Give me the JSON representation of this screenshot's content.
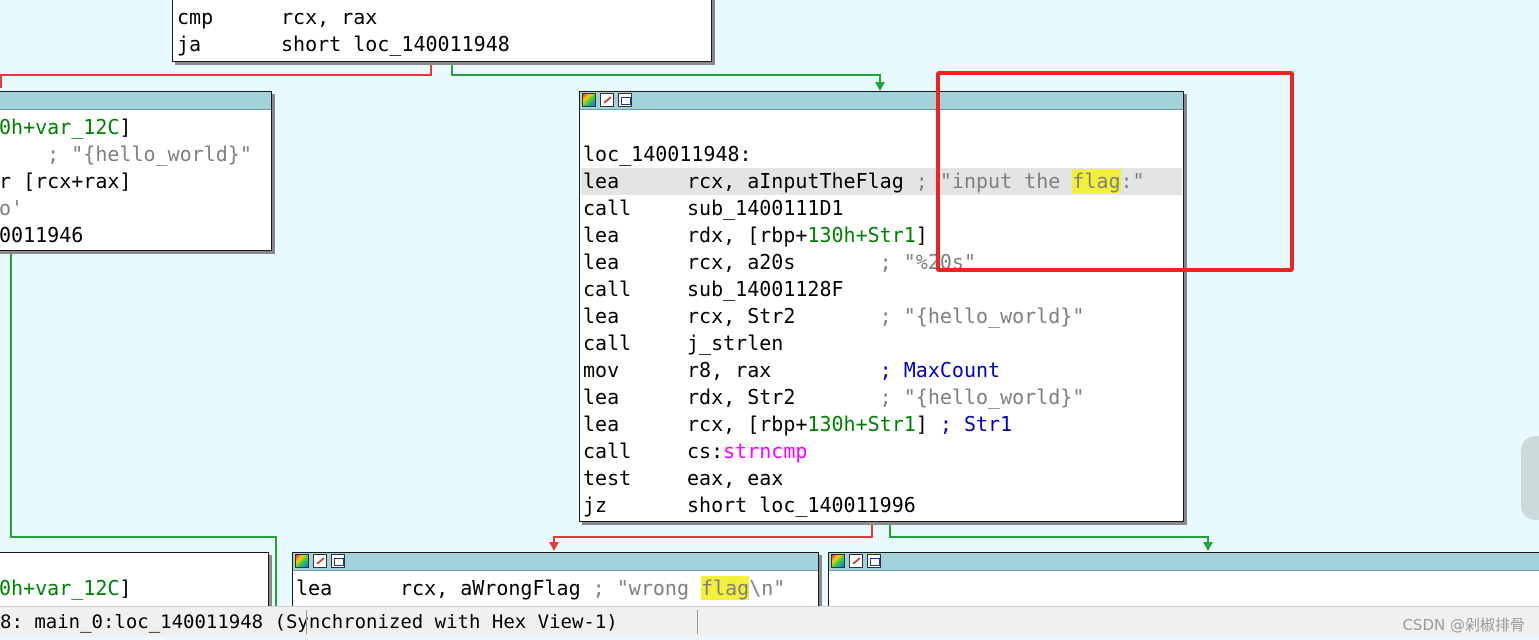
{
  "top_block": {
    "lines": [
      {
        "mnemonic": "cmp",
        "operands": "rcx, rax"
      },
      {
        "mnemonic": "ja",
        "operands": "short loc_140011948"
      }
    ]
  },
  "left_block": {
    "l1_green": "0h+var_12C",
    "l1_end": "]",
    "l2": "    ; \"{hello_world}\"",
    "l3": "r [rcx+rax]",
    "l4": "o'",
    "l5": "0011946"
  },
  "main_block": {
    "label": "loc_140011948:",
    "lines": [
      {
        "mnemonic": "lea",
        "op": "rcx, aInputTheFlag",
        "comment_pre": " ; \"input the ",
        "comment_hl": "flag",
        "comment_post": ":\""
      },
      {
        "mnemonic": "call",
        "op": "sub_1400111D1"
      },
      {
        "mnemonic": "lea",
        "op_pre": "rdx, [rbp+",
        "op_green": "130h+Str1",
        "op_post": "]"
      },
      {
        "mnemonic": "lea",
        "op": "rcx, a20s       ",
        "comment": "; \"%20s\""
      },
      {
        "mnemonic": "call",
        "op": "sub_14001128F"
      },
      {
        "mnemonic": "lea",
        "op": "rcx, Str2       ",
        "comment": "; \"{hello_world}\""
      },
      {
        "mnemonic": "call",
        "op": "j_strlen"
      },
      {
        "mnemonic": "mov",
        "op": "r8, rax         ",
        "comment_blue": "; MaxCount"
      },
      {
        "mnemonic": "lea",
        "op": "rdx, Str2       ",
        "comment": "; \"{hello_world}\""
      },
      {
        "mnemonic": "lea",
        "op_pre": "rcx, [rbp+",
        "op_green": "130h+Str1",
        "op_post": "] ",
        "comment_blue": "; Str1"
      },
      {
        "mnemonic": "call",
        "op_pre": "cs:",
        "op_magenta": "strncmp"
      },
      {
        "mnemonic": "test",
        "op": "eax, eax"
      },
      {
        "mnemonic": "jz",
        "op": "short loc_140011996"
      }
    ]
  },
  "bottom_left_block": {
    "l1_green": "0h+var_12C",
    "l1_end": "]"
  },
  "bottom_mid_block": {
    "mnemonic": "lea",
    "op": "rcx, aWrongFlag ",
    "comment_pre": "; \"wrong ",
    "comment_hl": "flag",
    "comment_post": "\\n\""
  },
  "status_bar": {
    "text": "8: main_0:loc_140011948 (Synchronized with Hex View-1)",
    "watermark": "CSDN @剁椒排骨"
  },
  "colors": {
    "background": "#e8fafe",
    "titlebar": "#a3d2da",
    "true_edge": "#26a23a",
    "false_edge": "#e23b3b",
    "highlight": "#f2f03a",
    "annotation_box": "#ee2424"
  }
}
